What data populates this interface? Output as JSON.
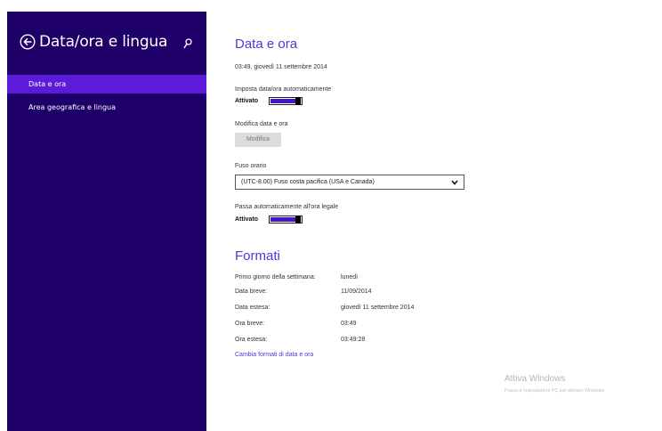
{
  "sidebar": {
    "title": "Data/ora e lingua",
    "items": [
      {
        "label": "Data e ora",
        "selected": true
      },
      {
        "label": "Area geografica e lingua",
        "selected": false
      }
    ]
  },
  "data_ora": {
    "heading": "Data e ora",
    "current_datetime": "03:49, giovedì 11 settembre 2014",
    "auto_time_label": "Imposta data/ora automaticamente",
    "auto_time_state": "Attivato",
    "change_label": "Modifica data e ora",
    "change_button": "Modifica",
    "timezone_label": "Fuso orario",
    "timezone_value": "(UTC-8.00) Fuso costa pacifica (USA e Canada)",
    "dst_label": "Passa automaticamente all'ora legale",
    "dst_state": "Attivato"
  },
  "formati": {
    "heading": "Formati",
    "rows": [
      {
        "label": "Primo giorno della settimana:",
        "value": "lunedì"
      },
      {
        "label": "Data breve:",
        "value": "11/09/2014"
      },
      {
        "label": "Data estesa:",
        "value": "giovedì 11 settembre 2014"
      },
      {
        "label": "Ora breve:",
        "value": "03:49"
      },
      {
        "label": "Ora estesa:",
        "value": "03:49:28"
      }
    ],
    "change_link": "Cambia formati di data e ora"
  },
  "watermark": {
    "line1": "Attiva Windows",
    "line2": "Passa a Impostazioni PC per attivare Windows."
  },
  "colors": {
    "sidebar_bg": "#1f0068",
    "selected_item_bg": "#5b1bd8",
    "accent": "#5b30d6",
    "toggle_fill": "#4619c8"
  },
  "icons": {
    "back": "back-arrow-circle-icon",
    "search": "search-icon",
    "dropdown": "chevron-down-icon"
  }
}
